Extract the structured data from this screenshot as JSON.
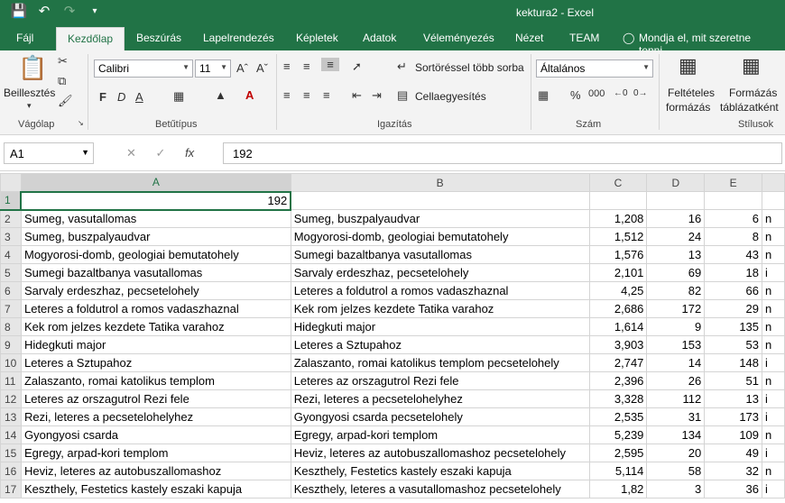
{
  "titlebar": {
    "title": "kektura2 - Excel"
  },
  "tabs": [
    {
      "label": "Fájl"
    },
    {
      "label": "Kezdőlap"
    },
    {
      "label": "Beszúrás"
    },
    {
      "label": "Lapelrendezés"
    },
    {
      "label": "Képletek"
    },
    {
      "label": "Adatok"
    },
    {
      "label": "Véleményezés"
    },
    {
      "label": "Nézet"
    },
    {
      "label": "TEAM"
    },
    {
      "label": "Mondja el, mit szeretne tenni..."
    }
  ],
  "ribbon": {
    "clipboard": {
      "paste": "Beillesztés",
      "label": "Vágólap"
    },
    "font": {
      "name": "Calibri",
      "size": "11",
      "label": "Betűtípus",
      "bold": "F",
      "italic": "D",
      "underline": "A"
    },
    "alignment": {
      "wrap": "Sortöréssel több sorba",
      "merge": "Cellaegyesítés",
      "label": "Igazítás"
    },
    "number": {
      "format": "Általános",
      "label": "Szám"
    },
    "styles": {
      "conditional_1": "Feltételes",
      "conditional_2": "formázás",
      "table_1": "Formázás",
      "table_2": "táblázatként",
      "label": "Stílusok"
    }
  },
  "formula_bar": {
    "name_box": "A1",
    "fx": "fx",
    "value": "192"
  },
  "columns": [
    "A",
    "B",
    "C",
    "D",
    "E",
    ""
  ],
  "rows": [
    {
      "n": "1",
      "a": "",
      "b": "",
      "c": "",
      "d": "",
      "e": "",
      "f": "",
      "a_num": "192"
    },
    {
      "n": "2",
      "a": "Sumeg, vasutallomas",
      "b": "Sumeg, buszpalyaudvar",
      "c": "1,208",
      "d": "16",
      "e": "6",
      "f": "n"
    },
    {
      "n": "3",
      "a": "Sumeg, buszpalyaudvar",
      "b": "Mogyorosi-domb, geologiai bemutatohely",
      "c": "1,512",
      "d": "24",
      "e": "8",
      "f": "n"
    },
    {
      "n": "4",
      "a": "Mogyorosi-domb, geologiai bemutatohely",
      "b": "Sumegi bazaltbanya vasutallomas",
      "c": "1,576",
      "d": "13",
      "e": "43",
      "f": "n"
    },
    {
      "n": "5",
      "a": "Sumegi bazaltbanya vasutallomas",
      "b": "Sarvaly erdeszhaz, pecsetelohely",
      "c": "2,101",
      "d": "69",
      "e": "18",
      "f": "i"
    },
    {
      "n": "6",
      "a": "Sarvaly erdeszhaz, pecsetelohely",
      "b": "Leteres a foldutrol a romos vadaszhaznal",
      "c": "4,25",
      "d": "82",
      "e": "66",
      "f": "n"
    },
    {
      "n": "7",
      "a": "Leteres a foldutrol a romos vadaszhaznal",
      "b": "Kek rom jelzes kezdete Tatika varahoz",
      "c": "2,686",
      "d": "172",
      "e": "29",
      "f": "n"
    },
    {
      "n": "8",
      "a": "Kek rom jelzes kezdete Tatika varahoz",
      "b": "Hidegkuti major",
      "c": "1,614",
      "d": "9",
      "e": "135",
      "f": "n"
    },
    {
      "n": "9",
      "a": "Hidegkuti major",
      "b": "Leteres a Sztupahoz",
      "c": "3,903",
      "d": "153",
      "e": "53",
      "f": "n"
    },
    {
      "n": "10",
      "a": "Leteres a Sztupahoz",
      "b": "Zalaszanto, romai katolikus templom pecsetelohely",
      "c": "2,747",
      "d": "14",
      "e": "148",
      "f": "i"
    },
    {
      "n": "11",
      "a": "Zalaszanto, romai katolikus templom",
      "b": "Leteres az orszagutrol Rezi fele",
      "c": "2,396",
      "d": "26",
      "e": "51",
      "f": "n"
    },
    {
      "n": "12",
      "a": "Leteres az orszagutrol Rezi fele",
      "b": "Rezi, leteres a pecsetelohelyhez",
      "c": "3,328",
      "d": "112",
      "e": "13",
      "f": "i"
    },
    {
      "n": "13",
      "a": "Rezi, leteres a pecsetelohelyhez",
      "b": "Gyongyosi csarda pecsetelohely",
      "c": "2,535",
      "d": "31",
      "e": "173",
      "f": "i"
    },
    {
      "n": "14",
      "a": "Gyongyosi csarda",
      "b": "Egregy, arpad-kori templom",
      "c": "5,239",
      "d": "134",
      "e": "109",
      "f": "n"
    },
    {
      "n": "15",
      "a": "Egregy, arpad-kori templom",
      "b": "Heviz, leteres az autobuszallomashoz pecsetelohely",
      "c": "2,595",
      "d": "20",
      "e": "49",
      "f": "i"
    },
    {
      "n": "16",
      "a": "Heviz, leteres az autobuszallomashoz",
      "b": "Keszthely, Festetics kastely eszaki kapuja",
      "c": "5,114",
      "d": "58",
      "e": "32",
      "f": "n"
    },
    {
      "n": "17",
      "a": "Keszthely, Festetics kastely eszaki kapuja",
      "b": "Keszthely, leteres a vasutallomashoz pecsetelohely",
      "c": "1,82",
      "d": "3",
      "e": "36",
      "f": "i"
    }
  ]
}
